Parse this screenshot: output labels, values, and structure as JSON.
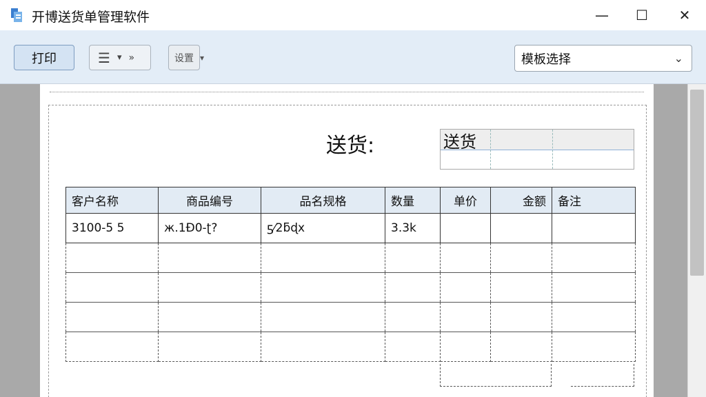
{
  "window": {
    "title": "开博送货单管理软件",
    "app_icon": "app-logo-icon",
    "minimize": "—",
    "maximize": "☐",
    "close": "✕"
  },
  "toolbar": {
    "print_label": "打印",
    "menu_icon": "☰",
    "menu_caret": "▾",
    "menu_extra": "»",
    "settings_label": "设置",
    "settings_caret": "▾",
    "template_select": {
      "value": "模板选择",
      "chevron": "⌄"
    }
  },
  "document": {
    "heading": "送货:",
    "header_field_value": "送货",
    "table": {
      "columns": [
        "客户名称",
        "商品编号",
        "品名规格",
        "数量",
        "单价",
        "金额",
        "备注"
      ],
      "rows": [
        [
          "3100-5 5",
          "ж.1Ð0-ʈ?",
          "ƽ⁄2ƃɖх",
          "3.3k",
          "",
          "",
          ""
        ],
        [
          "",
          "",
          "",
          "",
          "",
          "",
          ""
        ],
        [
          "",
          "",
          "",
          "",
          "",
          "",
          ""
        ],
        [
          "",
          "",
          "",
          "",
          "",
          "",
          ""
        ],
        [
          "",
          "",
          "",
          "",
          "",
          "",
          ""
        ]
      ]
    }
  },
  "colors": {
    "toolbar_bg": "#e3edf7",
    "print_button_bg": "#d4e3f3",
    "workspace_bg": "#a9a9a9",
    "table_header_bg": "#e2ebf4"
  }
}
